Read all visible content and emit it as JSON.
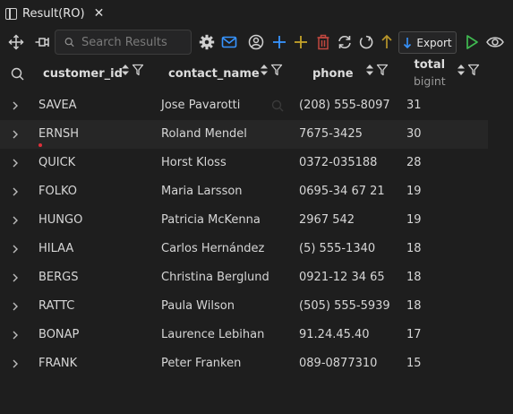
{
  "tab": {
    "label": "Result(RO)"
  },
  "toolbar": {
    "search_placeholder": "Search Results",
    "export_label": "Export"
  },
  "columns": [
    {
      "name": "customer_id",
      "type": ""
    },
    {
      "name": "contact_name",
      "type": ""
    },
    {
      "name": "phone",
      "type": ""
    },
    {
      "name": "total",
      "type": "bigint"
    }
  ],
  "rows": [
    {
      "customer_id": "SAVEA",
      "contact_name": "Jose Pavarotti",
      "phone": "(208) 555-8097",
      "total": "31"
    },
    {
      "customer_id": "ERNSH",
      "contact_name": "Roland Mendel",
      "phone": "7675-3425",
      "total": "30"
    },
    {
      "customer_id": "QUICK",
      "contact_name": "Horst Kloss",
      "phone": "0372-035188",
      "total": "28"
    },
    {
      "customer_id": "FOLKO",
      "contact_name": "Maria Larsson",
      "phone": "0695-34 67 21",
      "total": "19"
    },
    {
      "customer_id": "HUNGO",
      "contact_name": "Patricia McKenna",
      "phone": "2967 542",
      "total": "19"
    },
    {
      "customer_id": "HILAA",
      "contact_name": "Carlos Hernández",
      "phone": "(5) 555-1340",
      "total": "18"
    },
    {
      "customer_id": "BERGS",
      "contact_name": "Christina Berglund",
      "phone": "0921-12 34 65",
      "total": "18"
    },
    {
      "customer_id": "RATTC",
      "contact_name": "Paula Wilson",
      "phone": "(505) 555-5939",
      "total": "18"
    },
    {
      "customer_id": "BONAP",
      "contact_name": "Laurence Lebihan",
      "phone": "91.24.45.40",
      "total": "17"
    },
    {
      "customer_id": "FRANK",
      "contact_name": "Peter Franken",
      "phone": "089-0877310",
      "total": "15"
    }
  ],
  "colors": {
    "accent_blue": "#3794ff",
    "add_blue": "#3794ff",
    "add_yellow": "#c5a32a",
    "delete_red": "#c0473f",
    "up_arrow": "#b8952a",
    "run_green": "#3fb950",
    "marker_red": "#e0303a"
  }
}
